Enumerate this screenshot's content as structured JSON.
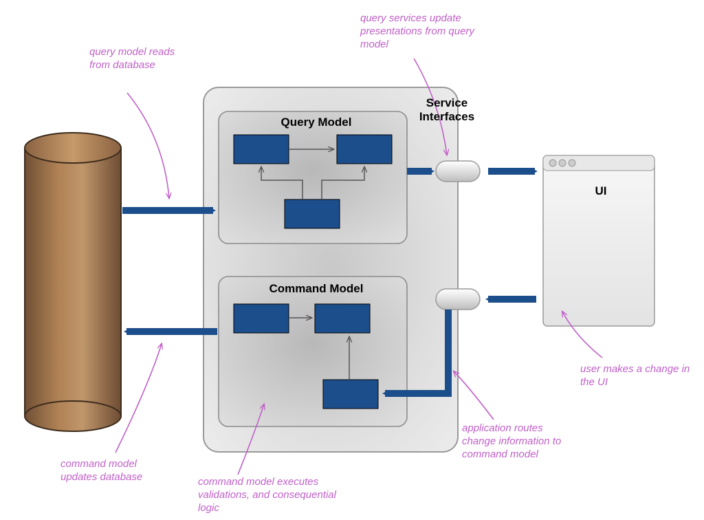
{
  "labels": {
    "query_model": "Query Model",
    "command_model": "Command Model",
    "service_interfaces": "Service Interfaces",
    "ui": "UI"
  },
  "annotations": {
    "query_reads": "query model reads from database",
    "query_services": "query services update presentations from query model",
    "user_change": "user makes a change in the UI",
    "app_routes": "application routes change information to command model",
    "cmd_exec": "command model executes validations, and consequential logic",
    "cmd_updates": "command model updates database"
  },
  "colors": {
    "database_fill": "#9c7050",
    "database_stroke": "#5a412e",
    "panel_fill": "#e6e6e6",
    "inner_fill": "#d6d6d6",
    "block_fill": "#1c4e8c",
    "block_stroke": "#000000",
    "flow_arrow": "#1c4e8c",
    "thin_arrow": "#555555",
    "pink_arrow": "#c060c8",
    "ui_fill": "#eeeeee"
  }
}
